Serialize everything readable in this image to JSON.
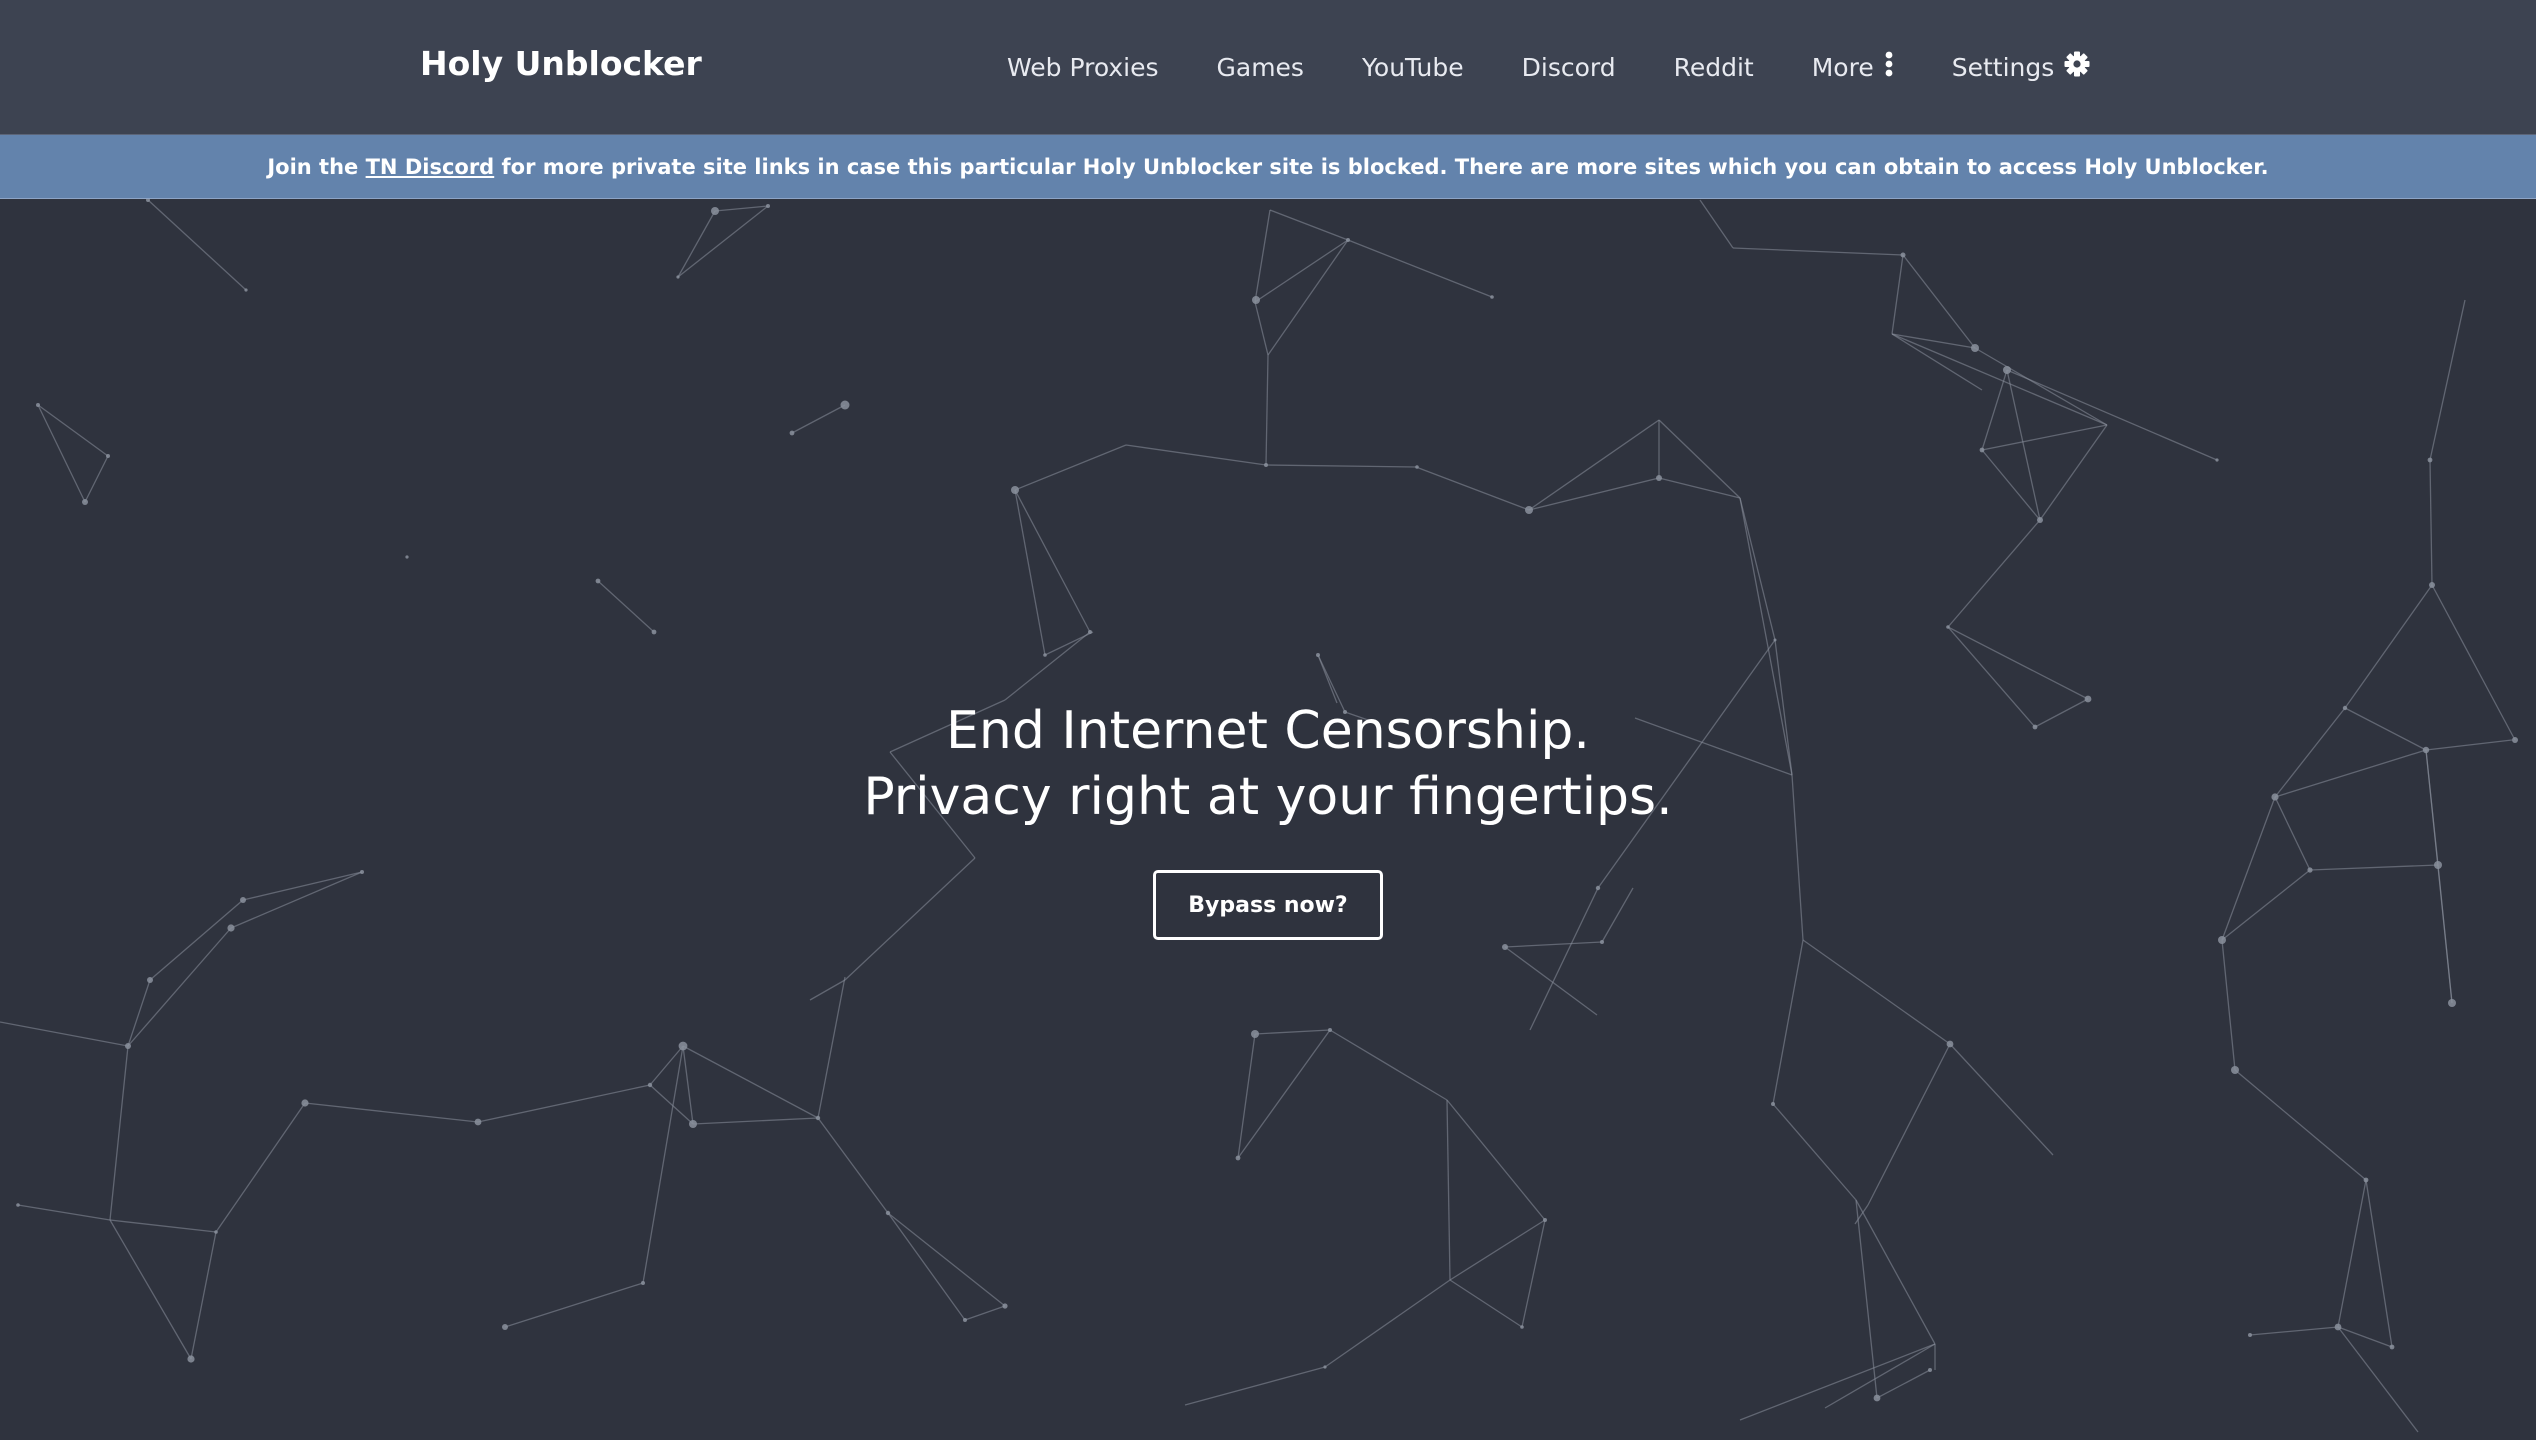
{
  "brand": {
    "name": "Holy Unblocker"
  },
  "nav": {
    "items": [
      {
        "label": "Web Proxies",
        "icon": null
      },
      {
        "label": "Games",
        "icon": null
      },
      {
        "label": "YouTube",
        "icon": null
      },
      {
        "label": "Discord",
        "icon": null
      },
      {
        "label": "Reddit",
        "icon": null
      },
      {
        "label": "More",
        "icon": "vertical-ellipsis-icon"
      },
      {
        "label": "Settings",
        "icon": "gear-icon"
      }
    ]
  },
  "banner": {
    "prefix": "Join the ",
    "link_text": "TN Discord",
    "suffix": " for more private site links in case this particular Holy Unblocker site is blocked. There are more sites which you can obtain to access Holy Unblocker."
  },
  "hero": {
    "line1": "End Internet Censorship.",
    "line2": "Privacy right at your fingertips.",
    "button_label": "Bypass now?"
  },
  "colors": {
    "background": "#2f333e",
    "navbar": "#3d4351",
    "banner": "#6383ac",
    "network": "#8a909c"
  }
}
